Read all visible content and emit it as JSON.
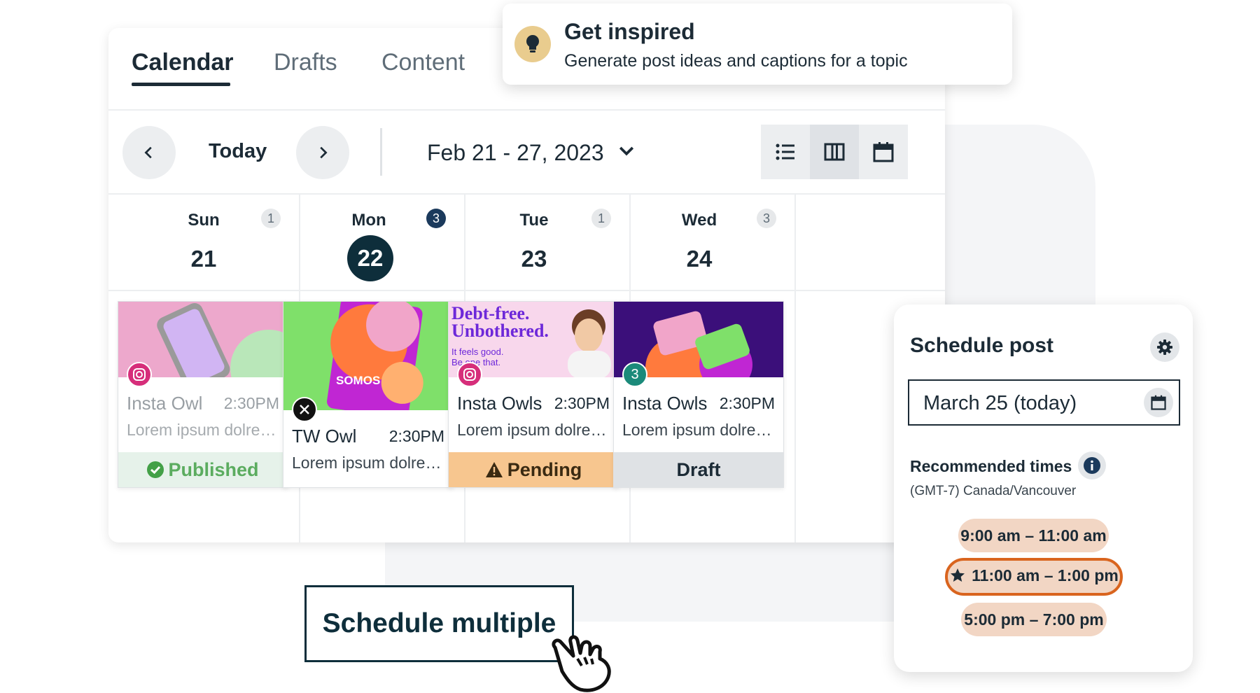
{
  "tabs": [
    {
      "label": "Calendar",
      "active": true
    },
    {
      "label": "Drafts",
      "active": false
    },
    {
      "label": "Content",
      "active": false
    }
  ],
  "toolbar": {
    "today_label": "Today",
    "date_range": "Feb 21 - 27, 2023",
    "views": [
      "list-view-icon",
      "column-view-icon",
      "calendar-view-icon"
    ]
  },
  "days": [
    {
      "name": "Sun",
      "number": "21",
      "count": "1",
      "today": false
    },
    {
      "name": "Mon",
      "number": "22",
      "count": "3",
      "today": true
    },
    {
      "name": "Tue",
      "number": "23",
      "count": "1",
      "today": false
    },
    {
      "name": "Wed",
      "number": "24",
      "count": "3",
      "today": false
    }
  ],
  "posts": [
    {
      "title": "Insta Owl",
      "time": "2:30PM",
      "desc": "Lorem ipsum dolre…",
      "status": "Published",
      "network": "instagram-icon",
      "status_color": "#43a047"
    },
    {
      "title": "TW Owl",
      "time": "2:30PM",
      "desc": "Lorem ipsum dolre…",
      "status": "",
      "network": "x-icon",
      "thumb_text": "SOMOS"
    },
    {
      "title": "Insta Owls",
      "time": "2:30PM",
      "desc": "Lorem ipsum dolre…",
      "status": "Pending",
      "network": "instagram-icon",
      "status_color": "#f7c68f",
      "thumb_headline": "Debt-free. Unbothered.",
      "thumb_sub": "It feels good. Be one that."
    },
    {
      "title": "Insta Owls",
      "time": "2:30PM",
      "desc": "Lorem ipsum dolrem…",
      "status": "Draft",
      "network_count": "3",
      "status_color": "#dfe2e5"
    }
  ],
  "inspired": {
    "title": "Get inspired",
    "subtitle": "Generate post ideas and captions for a topic",
    "icon": "lightbulb-icon"
  },
  "schedule": {
    "title": "Schedule post",
    "date_value": "March 25 (today)",
    "recommended_label": "Recommended times",
    "timezone": "(GMT-7) Canada/Vancouver",
    "slots": [
      {
        "label": "9:00 am – 11:00 am",
        "selected": false
      },
      {
        "label": "11:00 am – 1:00 pm",
        "selected": true
      },
      {
        "label": "5:00 pm – 7:00 pm",
        "selected": false
      }
    ]
  },
  "multi": {
    "label": "Schedule multiple"
  },
  "colors": {
    "dark": "#0e2e3b",
    "accent": "#d9641e",
    "slot_bg": "#f2d6c4"
  }
}
